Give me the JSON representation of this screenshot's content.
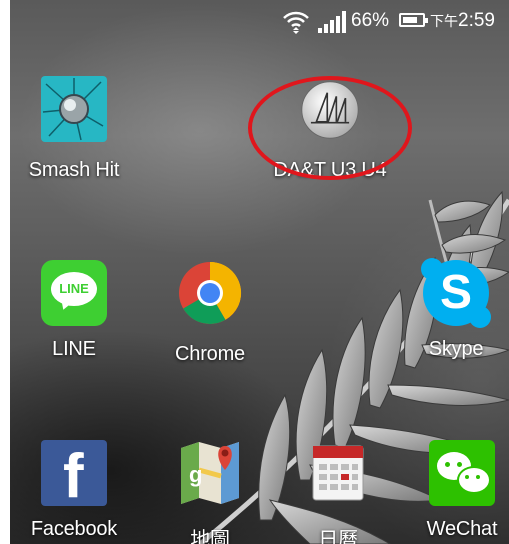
{
  "status_bar": {
    "battery_percent": "66%",
    "clock_period": "下午",
    "clock_time": "2:59",
    "icons": [
      "wifi-icon",
      "signal-icon",
      "battery-icon"
    ]
  },
  "apps": [
    {
      "label": "Smash Hit",
      "icon": "smash-hit-icon"
    },
    {
      "label": "DA&T U3 U4",
      "icon": "sailboat-icon"
    },
    {
      "label": "LINE",
      "icon": "line-icon"
    },
    {
      "label": "Chrome",
      "icon": "chrome-icon"
    },
    {
      "label": "Skype",
      "icon": "skype-icon"
    },
    {
      "label": "Facebook",
      "icon": "facebook-icon"
    },
    {
      "label": "地圖",
      "icon": "maps-icon"
    },
    {
      "label": "日曆",
      "icon": "calendar-icon"
    },
    {
      "label": "WeChat",
      "icon": "wechat-icon"
    }
  ],
  "icon_text": {
    "line_badge": "LINE",
    "skype_badge": "S",
    "facebook_badge": "f"
  },
  "colors": {
    "highlight_ellipse": "#e0161c",
    "line_green": "#3ecf32",
    "skype_blue": "#00aff0",
    "facebook_blue": "#3b5998",
    "wechat_green": "#2dc100"
  }
}
